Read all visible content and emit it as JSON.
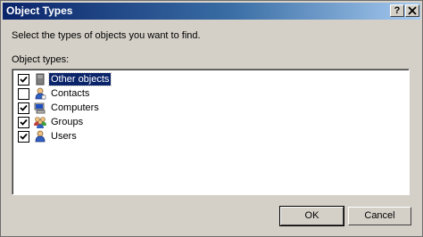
{
  "dialog": {
    "title": "Object Types",
    "help_glyph": "?",
    "close_glyph": "X",
    "instruction": "Select the types of objects you want to find.",
    "group_label": "Object types:"
  },
  "object_types": [
    {
      "label": "Other objects",
      "checked": true,
      "selected": true,
      "icon": "other-objects-icon"
    },
    {
      "label": "Contacts",
      "checked": false,
      "selected": false,
      "icon": "contact-icon"
    },
    {
      "label": "Computers",
      "checked": true,
      "selected": false,
      "icon": "computer-icon"
    },
    {
      "label": "Groups",
      "checked": true,
      "selected": false,
      "icon": "group-icon"
    },
    {
      "label": "Users",
      "checked": true,
      "selected": false,
      "icon": "user-icon"
    }
  ],
  "buttons": {
    "ok": "OK",
    "cancel": "Cancel"
  },
  "colors": {
    "title_active": "#0a246a",
    "selection": "#0a246a",
    "face": "#d4d0c8"
  }
}
